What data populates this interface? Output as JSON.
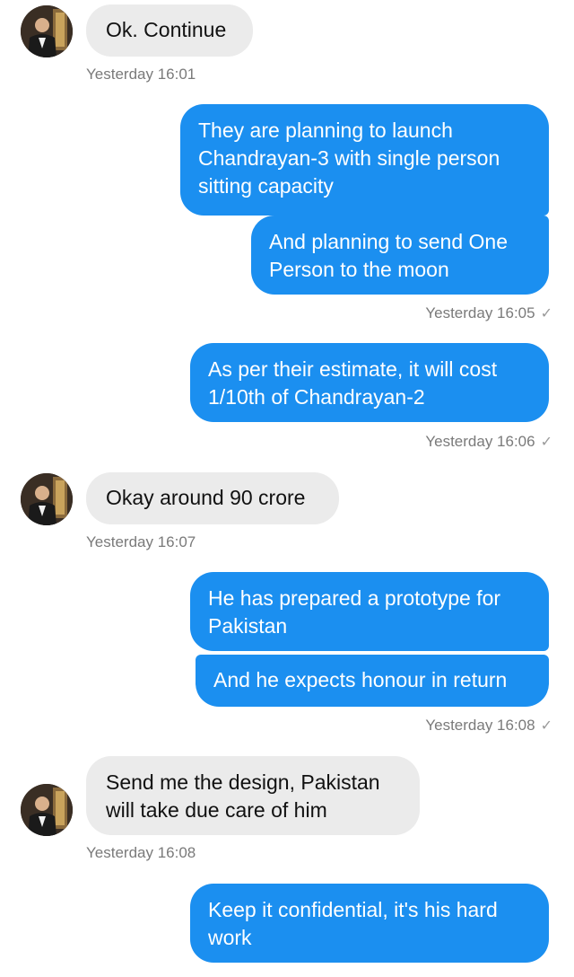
{
  "messages": [
    {
      "text": "Ok. Continue"
    },
    {
      "text": "They are planning to launch Chandrayan-3 with single person sitting capacity"
    },
    {
      "text": "And planning to send One Person to the moon"
    },
    {
      "text": "As per their estimate, it will cost 1/10th of Chandrayan-2"
    },
    {
      "text": "Okay around 90 crore"
    },
    {
      "text": "He has prepared a prototype for Pakistan"
    },
    {
      "text": "And he expects honour in return"
    },
    {
      "text": "Send me the design, Pakistan will take due care of him"
    },
    {
      "text": "Keep it confidential, it's his hard work"
    }
  ],
  "timestamps": [
    "Yesterday 16:01",
    "Yesterday 16:05",
    "Yesterday 16:06",
    "Yesterday 16:07",
    "Yesterday 16:08",
    "Yesterday 16:08"
  ],
  "read_check": "✓",
  "colors": {
    "outgoing": "#1b8ff0",
    "incoming": "#ebebeb"
  }
}
